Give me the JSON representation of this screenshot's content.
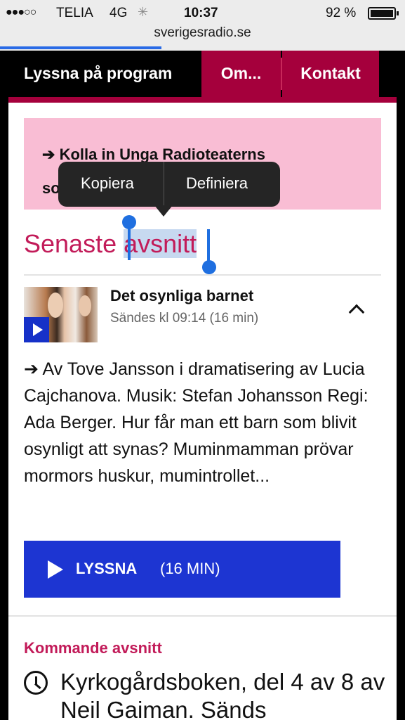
{
  "status_bar": {
    "signal": "●●●○○",
    "carrier": "TELIA",
    "network": "4G",
    "time": "10:37",
    "battery": "92 %"
  },
  "browser": {
    "url": "sverigesradio.se"
  },
  "nav": {
    "items": [
      {
        "label": "Lyssna på program"
      },
      {
        "label": "Om..."
      },
      {
        "label": "Kontakt"
      }
    ]
  },
  "promo": {
    "arrow": "➔",
    "text_line1": "Kolla in Unga Radioteaterns",
    "text_line2_visible": "so"
  },
  "section": {
    "title_plain": "Senaste ",
    "title_selected": "avsnitt"
  },
  "episode": {
    "title": "Det osynliga barnet",
    "meta": "Sändes kl 09:14  (16 min)",
    "description": "➔ Av Tove Jansson i dramatisering av Lucia Cajchanova. Musik: Stefan Johansson Regi: Ada Berger. Hur får man ett barn som blivit osynligt att synas? Muminmamman prövar mormors huskur, mumintrollet...",
    "listen_label": "LYSSNA",
    "listen_duration": "(16 MIN)"
  },
  "upcoming": {
    "title": "Kommande avsnitt",
    "item_text": "Kyrkogårdsboken, del 4 av 8 av Neil Gaiman. Sänds"
  },
  "popover": {
    "copy_label": "Kopiera",
    "define_label": "Definiera"
  },
  "colors": {
    "brand_red": "#a5003c",
    "accent_pink": "#c21b59",
    "listen_blue": "#1d35d2",
    "promo_pink": "#f9bdd4"
  }
}
